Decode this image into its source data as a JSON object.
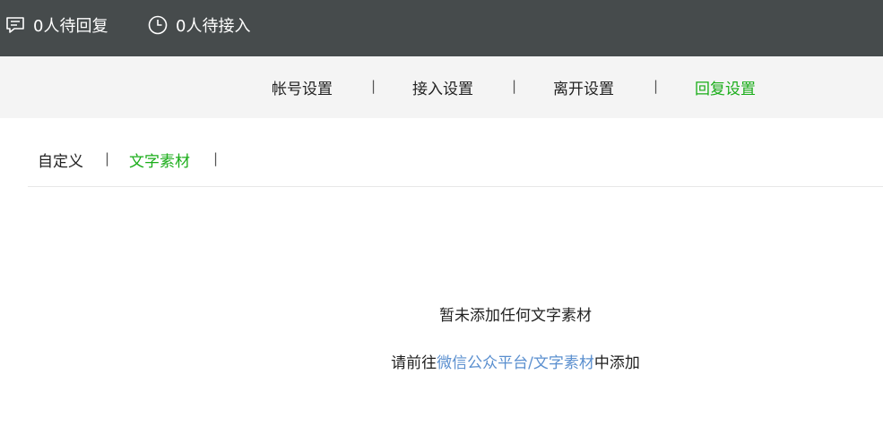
{
  "topbar": {
    "waiting_reply": {
      "text": "0人待回复",
      "icon": "message-icon"
    },
    "waiting_access": {
      "text": "0人待接入",
      "icon": "clock-icon"
    }
  },
  "settings_tabs": [
    {
      "label": "帐号设置",
      "active": false
    },
    {
      "label": "接入设置",
      "active": false
    },
    {
      "label": "离开设置",
      "active": false
    },
    {
      "label": "回复设置",
      "active": true
    }
  ],
  "separator": "|",
  "reply_subtabs": [
    {
      "label": "自定义",
      "active": false
    },
    {
      "label": "文字素材",
      "active": true
    }
  ],
  "empty_state": {
    "title": "暂未添加任何文字素材",
    "hint_prefix": "请前往",
    "hint_link": "微信公众平台/文字素材",
    "hint_suffix": "中添加"
  },
  "colors": {
    "topbar_bg": "#464b4c",
    "active_green": "#1aad19",
    "link_blue": "#5a8fcf"
  }
}
